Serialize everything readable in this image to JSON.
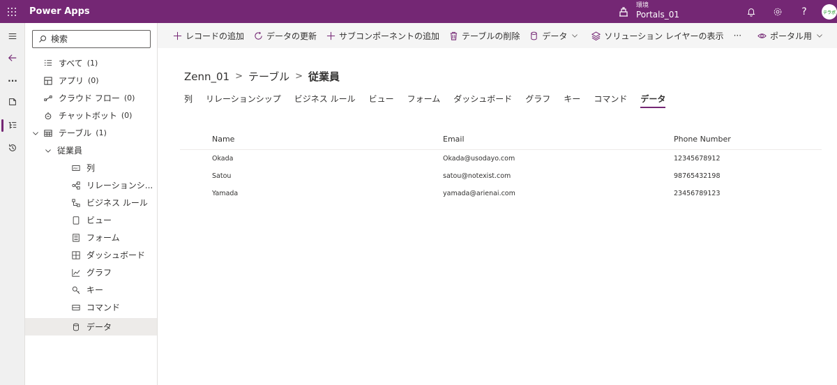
{
  "topbar": {
    "app_name": "Power Apps",
    "env_label": "環境",
    "env_name": "Portals_01",
    "avatar_text": "テラボ"
  },
  "tree": {
    "search_placeholder": "検索",
    "items": [
      {
        "label": "すべて",
        "count": "(1)"
      },
      {
        "label": "アプリ",
        "count": "(0)"
      },
      {
        "label": "クラウド フロー",
        "count": "(0)"
      },
      {
        "label": "チャットボット",
        "count": "(0)"
      },
      {
        "label": "テーブル",
        "count": "(1)"
      },
      {
        "label": "従業員",
        "count": ""
      },
      {
        "label": "列",
        "count": ""
      },
      {
        "label": "リレーションシ...",
        "count": ""
      },
      {
        "label": "ビジネス ルール",
        "count": ""
      },
      {
        "label": "ビュー",
        "count": ""
      },
      {
        "label": "フォーム",
        "count": ""
      },
      {
        "label": "ダッシュボード",
        "count": ""
      },
      {
        "label": "グラフ",
        "count": ""
      },
      {
        "label": "キー",
        "count": ""
      },
      {
        "label": "コマンド",
        "count": ""
      },
      {
        "label": "データ",
        "count": ""
      }
    ]
  },
  "commands": {
    "add_record": "レコードの追加",
    "refresh": "データの更新",
    "add_subcomponent": "サブコンポーネントの追加",
    "delete_table": "テーブルの削除",
    "data": "データ",
    "solution_layers": "ソリューション レイヤーの表示",
    "more": "···",
    "portal": "ポータル用"
  },
  "breadcrumb": {
    "root": "Zenn_01",
    "tables": "テーブル",
    "current": "従業員"
  },
  "tabs": [
    "列",
    "リレーションシップ",
    "ビジネス ルール",
    "ビュー",
    "フォーム",
    "ダッシュボード",
    "グラフ",
    "キー",
    "コマンド",
    "データ"
  ],
  "grid": {
    "columns": [
      "Name",
      "Email",
      "Phone Number"
    ],
    "rows": [
      [
        "Okada",
        "Okada@usodayo.com",
        "12345678912"
      ],
      [
        "Satou",
        "satou@notexist.com",
        "98765432198"
      ],
      [
        "Yamada",
        "yamada@arienai.com",
        "23456789123"
      ]
    ]
  },
  "colors": {
    "accent": "#742774"
  }
}
